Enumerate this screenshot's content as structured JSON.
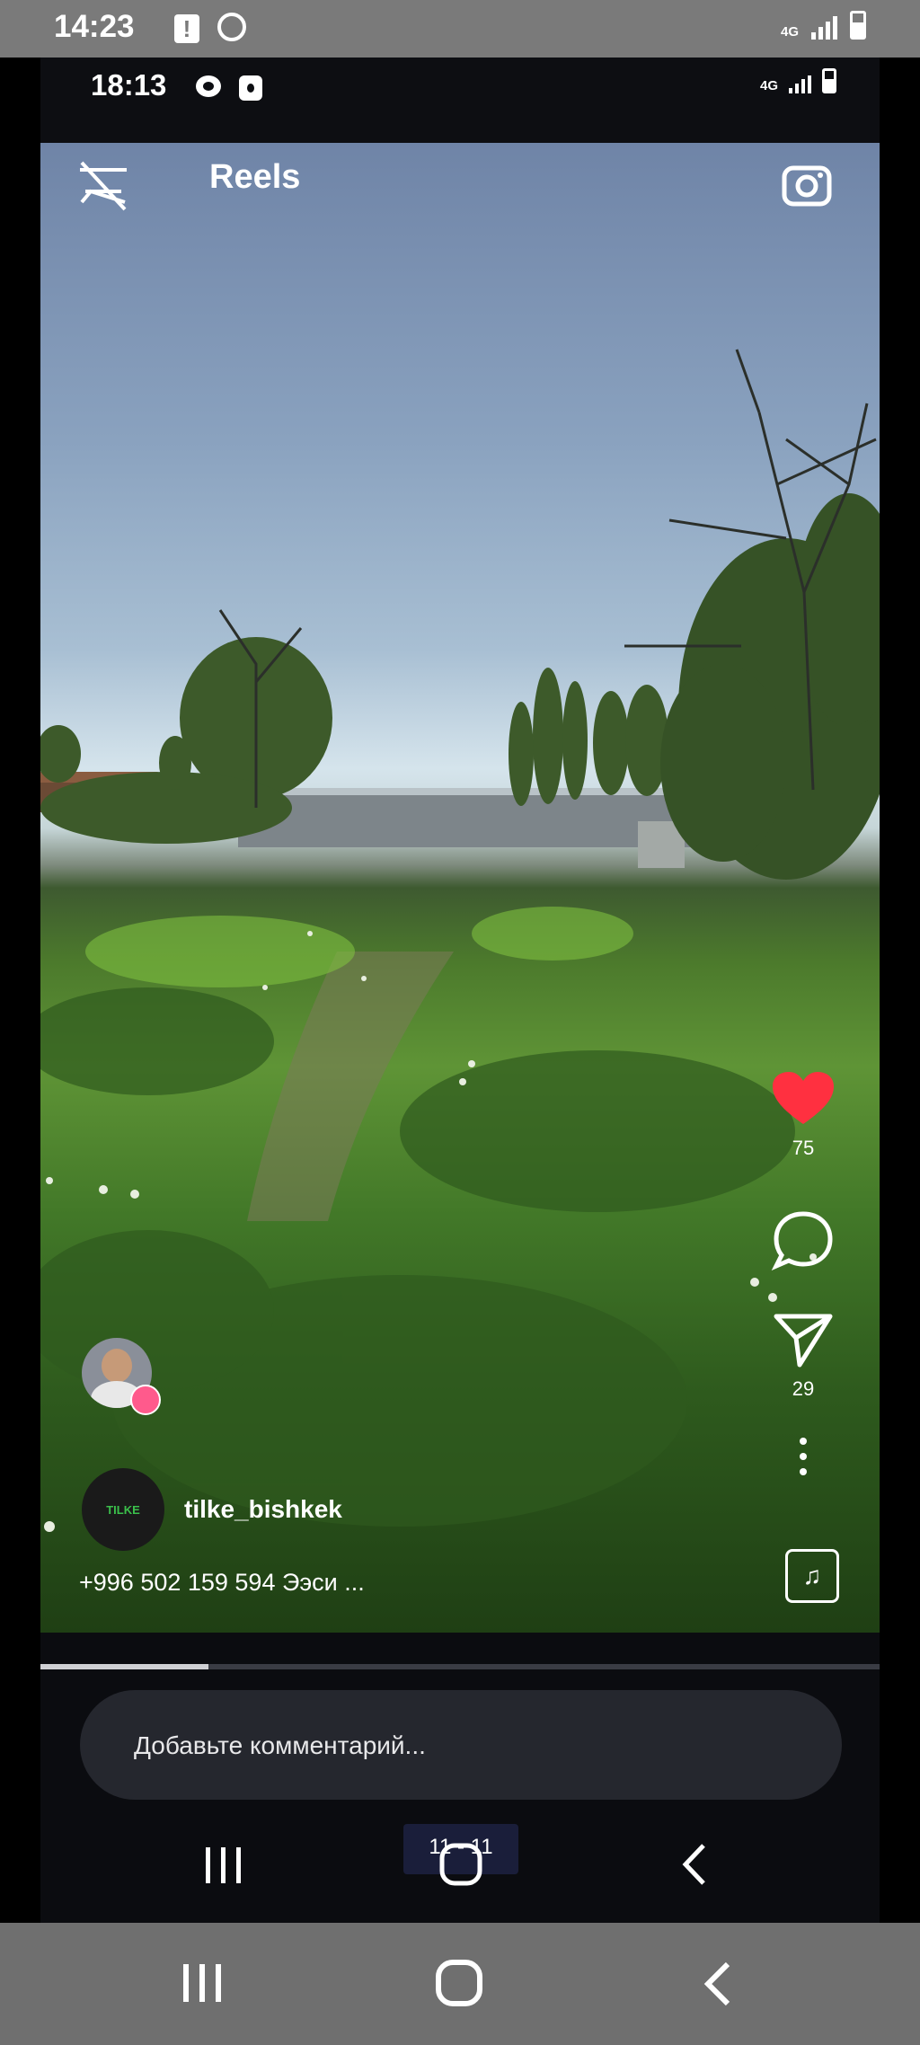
{
  "outer_status": {
    "time": "14:23",
    "network": "4G"
  },
  "inner_status": {
    "time": "18:13",
    "network": "4G"
  },
  "reels": {
    "title": "Reels"
  },
  "actions": {
    "likes": "75",
    "shares": "29"
  },
  "post": {
    "account_name": "tilke_bishkek",
    "logo_text": "TILKE",
    "caption": "+996 502 159 594 Ээси ..."
  },
  "comment": {
    "placeholder": "Добавьте комментарий..."
  },
  "inner_nav": {
    "badge": "11 - 11"
  },
  "colors": {
    "like": "#ff3040",
    "accent": "#3bc04b"
  }
}
